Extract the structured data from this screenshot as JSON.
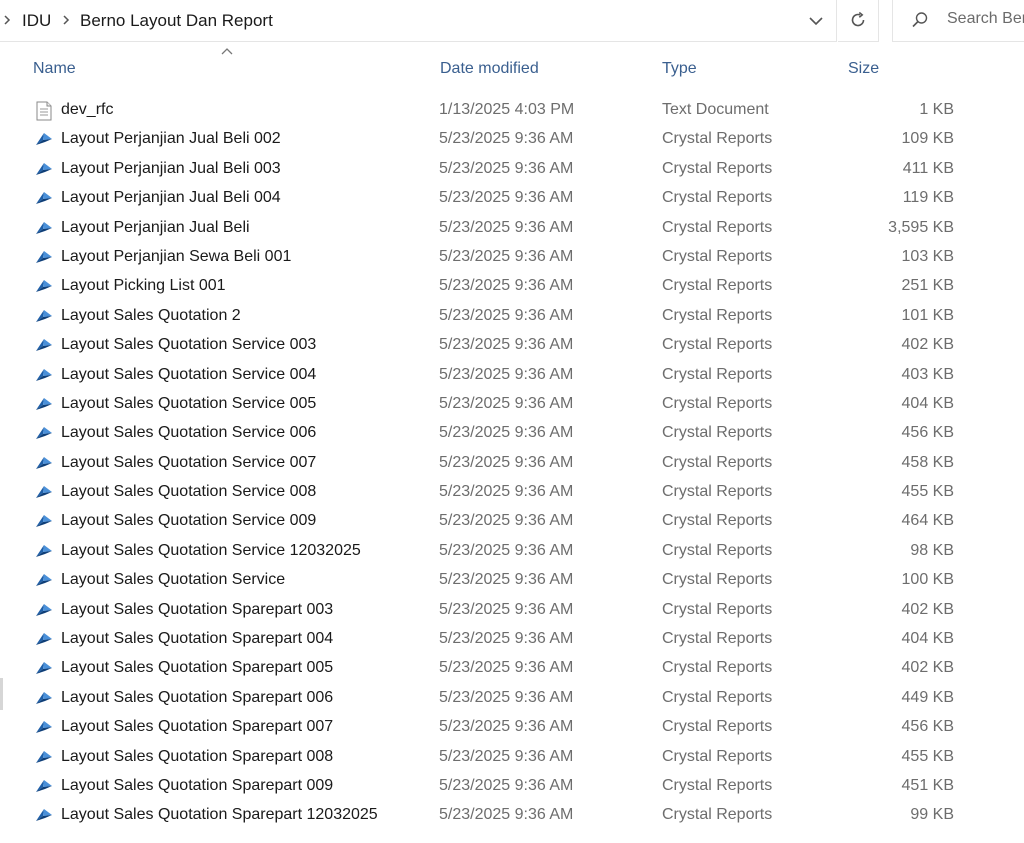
{
  "breadcrumb": {
    "items": [
      "IDU",
      "Berno Layout Dan Report"
    ]
  },
  "search": {
    "placeholder": "Search Berno Layout Dan Report"
  },
  "icons": {
    "breadcrumb_chevron": "chevron-right-icon",
    "address_dropdown": "chevron-down-icon",
    "refresh": "refresh-icon",
    "search": "search-icon",
    "sort": "sort-up-icon",
    "text_file": "text-document-icon",
    "crystal_file": "crystal-reports-icon"
  },
  "columns": {
    "name": "Name",
    "date": "Date modified",
    "type": "Type",
    "size": "Size"
  },
  "colors": {
    "header_text": "#3a5f8f",
    "crystal_icon": "#1e5fa8",
    "secondary_text": "#6d6d6d"
  },
  "files": [
    {
      "name": "dev_rfc",
      "date": "1/13/2025 4:03 PM",
      "type": "Text Document",
      "size": "1 KB",
      "icon": "text"
    },
    {
      "name": "Layout Perjanjian Jual Beli 002",
      "date": "5/23/2025 9:36 AM",
      "type": "Crystal Reports",
      "size": "109 KB",
      "icon": "crystal"
    },
    {
      "name": "Layout Perjanjian Jual Beli 003",
      "date": "5/23/2025 9:36 AM",
      "type": "Crystal Reports",
      "size": "411 KB",
      "icon": "crystal"
    },
    {
      "name": "Layout Perjanjian Jual Beli 004",
      "date": "5/23/2025 9:36 AM",
      "type": "Crystal Reports",
      "size": "119 KB",
      "icon": "crystal"
    },
    {
      "name": "Layout Perjanjian Jual Beli",
      "date": "5/23/2025 9:36 AM",
      "type": "Crystal Reports",
      "size": "3,595 KB",
      "icon": "crystal"
    },
    {
      "name": "Layout Perjanjian Sewa Beli 001",
      "date": "5/23/2025 9:36 AM",
      "type": "Crystal Reports",
      "size": "103 KB",
      "icon": "crystal"
    },
    {
      "name": "Layout Picking List 001",
      "date": "5/23/2025 9:36 AM",
      "type": "Crystal Reports",
      "size": "251 KB",
      "icon": "crystal"
    },
    {
      "name": "Layout Sales Quotation 2",
      "date": "5/23/2025 9:36 AM",
      "type": "Crystal Reports",
      "size": "101 KB",
      "icon": "crystal"
    },
    {
      "name": "Layout Sales Quotation Service 003",
      "date": "5/23/2025 9:36 AM",
      "type": "Crystal Reports",
      "size": "402 KB",
      "icon": "crystal"
    },
    {
      "name": "Layout Sales Quotation Service 004",
      "date": "5/23/2025 9:36 AM",
      "type": "Crystal Reports",
      "size": "403 KB",
      "icon": "crystal"
    },
    {
      "name": "Layout Sales Quotation Service 005",
      "date": "5/23/2025 9:36 AM",
      "type": "Crystal Reports",
      "size": "404 KB",
      "icon": "crystal"
    },
    {
      "name": "Layout Sales Quotation Service 006",
      "date": "5/23/2025 9:36 AM",
      "type": "Crystal Reports",
      "size": "456 KB",
      "icon": "crystal"
    },
    {
      "name": "Layout Sales Quotation Service 007",
      "date": "5/23/2025 9:36 AM",
      "type": "Crystal Reports",
      "size": "458 KB",
      "icon": "crystal"
    },
    {
      "name": "Layout Sales Quotation Service 008",
      "date": "5/23/2025 9:36 AM",
      "type": "Crystal Reports",
      "size": "455 KB",
      "icon": "crystal"
    },
    {
      "name": "Layout Sales Quotation Service 009",
      "date": "5/23/2025 9:36 AM",
      "type": "Crystal Reports",
      "size": "464 KB",
      "icon": "crystal"
    },
    {
      "name": "Layout Sales Quotation Service 12032025",
      "date": "5/23/2025 9:36 AM",
      "type": "Crystal Reports",
      "size": "98 KB",
      "icon": "crystal"
    },
    {
      "name": "Layout Sales Quotation Service",
      "date": "5/23/2025 9:36 AM",
      "type": "Crystal Reports",
      "size": "100 KB",
      "icon": "crystal"
    },
    {
      "name": "Layout Sales Quotation Sparepart 003",
      "date": "5/23/2025 9:36 AM",
      "type": "Crystal Reports",
      "size": "402 KB",
      "icon": "crystal"
    },
    {
      "name": "Layout Sales Quotation Sparepart 004",
      "date": "5/23/2025 9:36 AM",
      "type": "Crystal Reports",
      "size": "404 KB",
      "icon": "crystal"
    },
    {
      "name": "Layout Sales Quotation Sparepart 005",
      "date": "5/23/2025 9:36 AM",
      "type": "Crystal Reports",
      "size": "402 KB",
      "icon": "crystal"
    },
    {
      "name": "Layout Sales Quotation Sparepart 006",
      "date": "5/23/2025 9:36 AM",
      "type": "Crystal Reports",
      "size": "449 KB",
      "icon": "crystal"
    },
    {
      "name": "Layout Sales Quotation Sparepart 007",
      "date": "5/23/2025 9:36 AM",
      "type": "Crystal Reports",
      "size": "456 KB",
      "icon": "crystal"
    },
    {
      "name": "Layout Sales Quotation Sparepart 008",
      "date": "5/23/2025 9:36 AM",
      "type": "Crystal Reports",
      "size": "455 KB",
      "icon": "crystal"
    },
    {
      "name": "Layout Sales Quotation Sparepart 009",
      "date": "5/23/2025 9:36 AM",
      "type": "Crystal Reports",
      "size": "451 KB",
      "icon": "crystal"
    },
    {
      "name": "Layout Sales Quotation Sparepart 12032025",
      "date": "5/23/2025 9:36 AM",
      "type": "Crystal Reports",
      "size": "99 KB",
      "icon": "crystal"
    }
  ]
}
